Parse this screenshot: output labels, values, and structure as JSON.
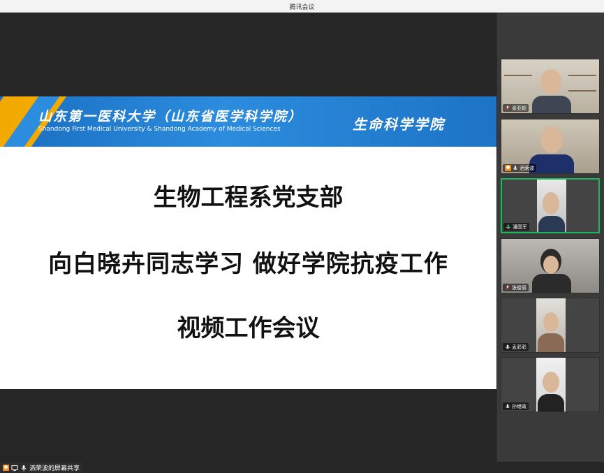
{
  "window": {
    "title": "腾讯会议"
  },
  "slide": {
    "banner_cn": "山东第一医科大学（山东省医学科学院）",
    "banner_en": "Shandong First Medical University  &  Shandong Academy of Medical Sciences",
    "school": "生命科学学院",
    "line1": "生物工程系党支部",
    "line2": "向白晓卉同志学习  做好学院抗疫工作",
    "line3": "视频工作会议"
  },
  "participants": [
    {
      "name": "张亚超"
    },
    {
      "name": "洒荣波"
    },
    {
      "name": "潘国军"
    },
    {
      "name": "张俊丽"
    },
    {
      "name": "孟彩彩"
    },
    {
      "name": "孙继政"
    }
  ],
  "status": {
    "share_label": "洒荣波的屏幕共享"
  },
  "colors": {
    "banner_blue": "#1a6ec2",
    "banner_gold": "#f2a900",
    "active_speaker": "#19b95c",
    "host_badge": "#f08a24"
  }
}
